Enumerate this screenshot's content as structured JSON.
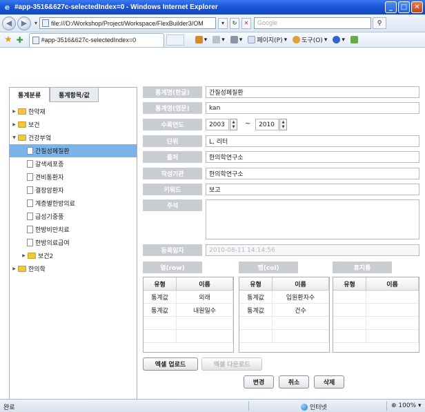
{
  "window": {
    "title": "#app-3516&627c-selectedIndex=0 - Windows Internet Explorer"
  },
  "addressbar": {
    "url": "file:///D:/Workshop/Project/Workspace/FlexBuilder3/OM",
    "search_placeholder": "Google"
  },
  "commandbar": {
    "tab_title": "#app-3516&627c-selectedIndex=0",
    "page_menu": "페이지(P)",
    "tools_menu": "도구(O)"
  },
  "left": {
    "tabs": [
      "통계분류",
      "통계항목/값"
    ],
    "tree": [
      {
        "label": "한약재",
        "type": "folder",
        "level": 0,
        "expanded": false
      },
      {
        "label": "보건",
        "type": "folder",
        "level": 0,
        "expanded": false
      },
      {
        "label": "건강부엌",
        "type": "folder",
        "level": 0,
        "expanded": true
      },
      {
        "label": "간질성폐질환",
        "type": "doc",
        "level": 1,
        "selected": true
      },
      {
        "label": "갈색세포종",
        "type": "doc",
        "level": 1
      },
      {
        "label": "견비통환자",
        "type": "doc",
        "level": 1
      },
      {
        "label": "결장암환자",
        "type": "doc",
        "level": 1
      },
      {
        "label": "계층별한방의료",
        "type": "doc",
        "level": 1
      },
      {
        "label": "급성기중풍",
        "type": "doc",
        "level": 1
      },
      {
        "label": "한방비만치료",
        "type": "doc",
        "level": 1
      },
      {
        "label": "한방의료급여",
        "type": "doc",
        "level": 1
      },
      {
        "label": "보건2",
        "type": "folder",
        "level": 1,
        "expanded": false
      },
      {
        "label": "한의학",
        "type": "folder",
        "level": 0,
        "expanded": false
      }
    ]
  },
  "form": {
    "name_kr_label": "통계명(한글)",
    "name_kr_value": "간질성폐질환",
    "name_en_label": "통계명(영문)",
    "name_en_value": "kan",
    "year_label": "수록연도",
    "year_from": "2003",
    "year_to": "2010",
    "unit_label": "단위",
    "unit_value": "L, 리터",
    "source_label": "출처",
    "source_value": "한의학연구소",
    "author_label": "작성기관",
    "author_value": "한의학연구소",
    "keyword_label": "키워드",
    "keyword_value": "보고",
    "note_label": "주석",
    "note_value": "",
    "regdate_label": "등록일자",
    "regdate_value": "2010-08-11 14:14:56"
  },
  "grids": {
    "row_title": "열(row)",
    "col_title": "행(col)",
    "rest_title": "휴지통",
    "head_type": "유형",
    "head_name": "이름",
    "row_items": [
      {
        "type": "통계값",
        "name": "외래"
      },
      {
        "type": "통계값",
        "name": "내원일수"
      }
    ],
    "col_items": [
      {
        "type": "통계값",
        "name": "입원환자수"
      },
      {
        "type": "통계값",
        "name": "건수"
      }
    ],
    "rest_items": []
  },
  "buttons": {
    "excel_upload": "엑셀 업로드",
    "excel_download": "엑셀 다운로드",
    "change": "변경",
    "cancel": "취소",
    "delete": "삭제"
  },
  "statusbar": {
    "status": "완료",
    "zone": "인터넷",
    "zoom": "100%"
  }
}
